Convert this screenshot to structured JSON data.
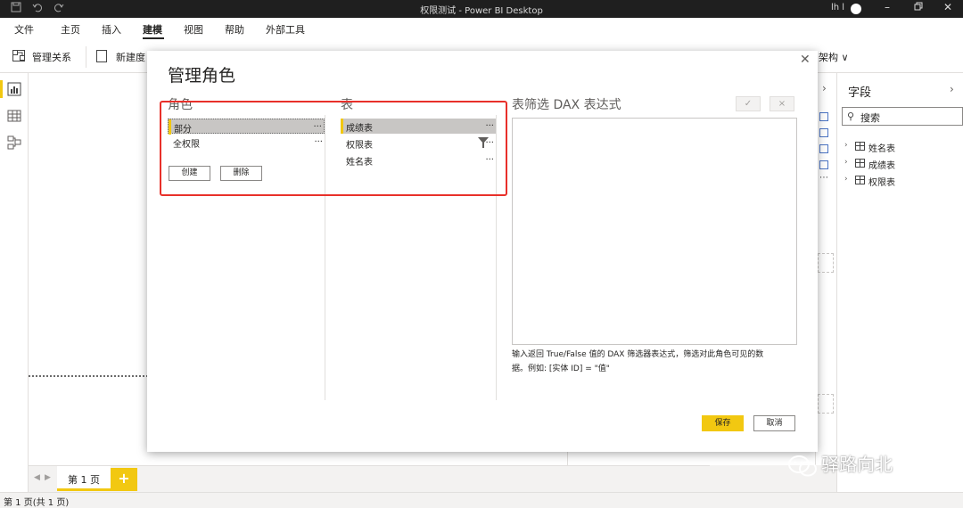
{
  "window": {
    "title": "权限测试 - Power BI Desktop",
    "user": "lh l",
    "icons": [
      "save-icon",
      "undo-icon",
      "redo-icon",
      "minimize-icon",
      "restore-icon",
      "close-icon"
    ]
  },
  "menu": {
    "tabs": [
      "文件",
      "主页",
      "插入",
      "建模",
      "视图",
      "帮助",
      "外部工具"
    ],
    "active": "建模"
  },
  "ribbon": {
    "manage_relationships": "管理关系",
    "new_measure": "新建度",
    "schema_fragment": "架构"
  },
  "fields_panel": {
    "title": "字段",
    "search_placeholder": "搜索",
    "tables": [
      "姓名表",
      "成绩表",
      "权限表"
    ]
  },
  "dialog": {
    "title": "管理角色",
    "roles_header": "角色",
    "tables_header": "表",
    "dax_header": "表筛选 DAX 表达式",
    "roles": [
      {
        "label": "部分",
        "more": "...",
        "selected": true
      },
      {
        "label": "全权限",
        "more": "..."
      }
    ],
    "tables": [
      {
        "label": "成绩表",
        "more": "...",
        "selected": true
      },
      {
        "label": "权限表",
        "more": "...",
        "filtered": true
      },
      {
        "label": "姓名表",
        "more": "..."
      }
    ],
    "create_label": "创建",
    "delete_label": "删除",
    "check_label": "✓",
    "x_label": "×",
    "hint_line1": "输入返回 True/False 值的 DAX 筛选器表达式，筛选对此角色可见的数",
    "hint_line2": "据。例如: [实体 ID] = \"值\"",
    "save_label": "保存",
    "cancel_label": "取消"
  },
  "pages": {
    "tabs": [
      "第 1 页"
    ],
    "add_label": "+"
  },
  "status": {
    "text": "第 1 页(共 1 页)"
  },
  "watermark": {
    "text": "驿路向北"
  },
  "colors": {
    "accent": "#f2c811",
    "highlight_border": "#e8302a",
    "titlebar": "#1f1f1f"
  }
}
